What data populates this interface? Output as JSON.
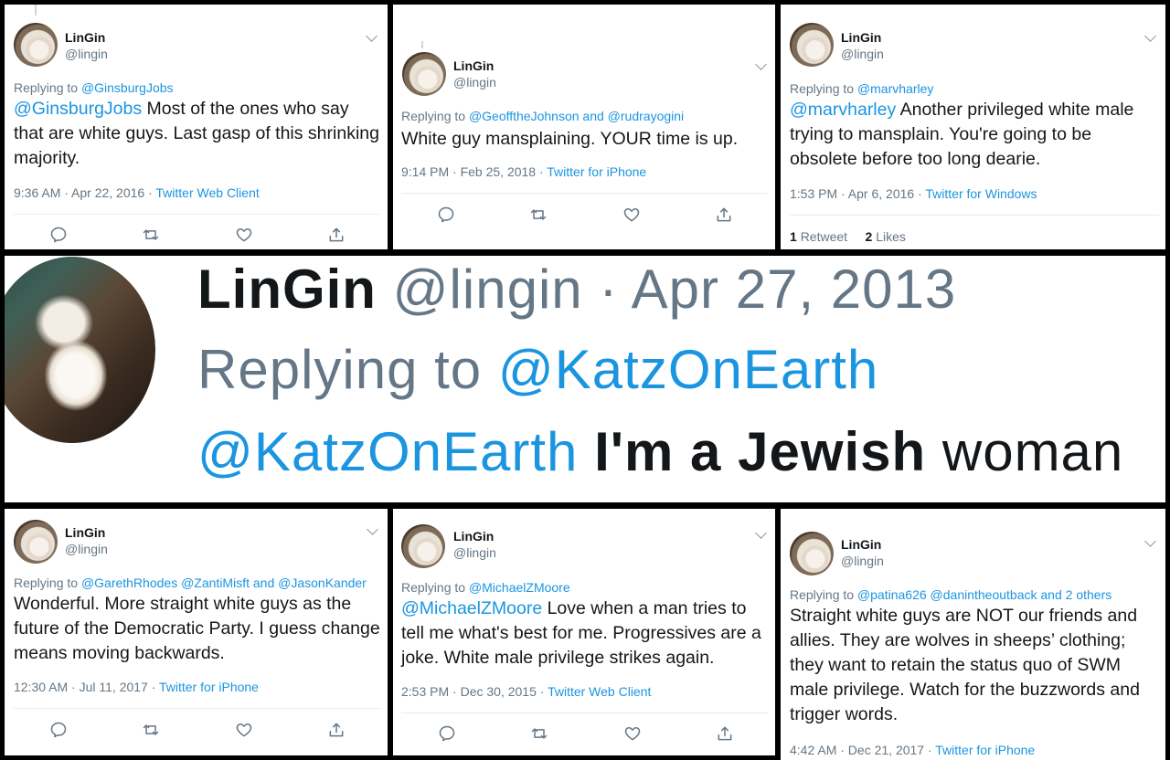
{
  "tweets": [
    {
      "name": "LinGin",
      "handle": "@lingin",
      "replying_label": "Replying to",
      "replying_to": "@GinsburgJobs",
      "mention": "@GinsburgJobs",
      "text": " Most of the ones who say that are white guys. Last gasp of this shrinking majority.",
      "time": "9:36 AM · Apr 22, 2016 · ",
      "source": "Twitter Web Client"
    },
    {
      "name": "LinGin",
      "handle": "@lingin",
      "replying_label": "Replying to",
      "replying_to": "@GeofftheJohnson and @rudrayogini",
      "mention": "",
      "text": "White guy mansplaining. YOUR time is up.",
      "time": "9:14 PM · Feb 25, 2018 · ",
      "source": "Twitter for iPhone"
    },
    {
      "name": "LinGin",
      "handle": "@lingin",
      "replying_label": "Replying to",
      "replying_to": "@marvharley",
      "mention": "@marvharley",
      "text": " Another privileged white male trying to mansplain. You're going to be obsolete before too long dearie.",
      "time": "1:53 PM · Apr 6, 2016 · ",
      "source": "Twitter for Windows",
      "retweets": "1",
      "retweets_label": "Retweet",
      "likes": "2",
      "likes_label": "Likes"
    },
    {
      "name": "LinGin",
      "handle": "@lingin",
      "replying_label": "Replying to",
      "replying_to": "@GarethRhodes @ZantiMisft and @JasonKander",
      "mention": "",
      "text": "Wonderful. More straight white guys as the future of the Democratic Party. I guess change means moving backwards.",
      "time": "12:30 AM · Jul 11, 2017 · ",
      "source": "Twitter for iPhone"
    },
    {
      "name": "LinGin",
      "handle": "@lingin",
      "replying_label": "Replying to",
      "replying_to": "@MichaelZMoore",
      "mention": "@MichaelZMoore",
      "text": " Love when a man tries to tell me what's best for me. Progressives are a joke. White male privilege strikes again.",
      "time": "2:53 PM · Dec 30, 2015 · ",
      "source": "Twitter Web Client"
    },
    {
      "name": "LinGin",
      "handle": "@lingin",
      "replying_label": "Replying to",
      "replying_to": "@patina626 @danintheoutback and 2 others",
      "mention": "",
      "text": "Straight white guys are NOT our friends and allies. They are wolves in sheeps’ clothing; they want to retain the status quo of SWM male privilege. Watch for the buzzwords and trigger words.",
      "time": "4:42 AM · Dec 21, 2017 · ",
      "source": "Twitter for iPhone"
    }
  ],
  "banner": {
    "name": "LinGin",
    "handle": "@lingin",
    "date": " · Apr 27, 2013",
    "replying_label": "Replying to ",
    "replying_to": "@KatzOnEarth",
    "mention": "@KatzOnEarth",
    "text_a": " I'm a ",
    "text_bold": "Jewish",
    "text_b": " woman"
  },
  "colors": {
    "link": "#1b95e0",
    "text": "#14171a",
    "muted": "#657786"
  }
}
